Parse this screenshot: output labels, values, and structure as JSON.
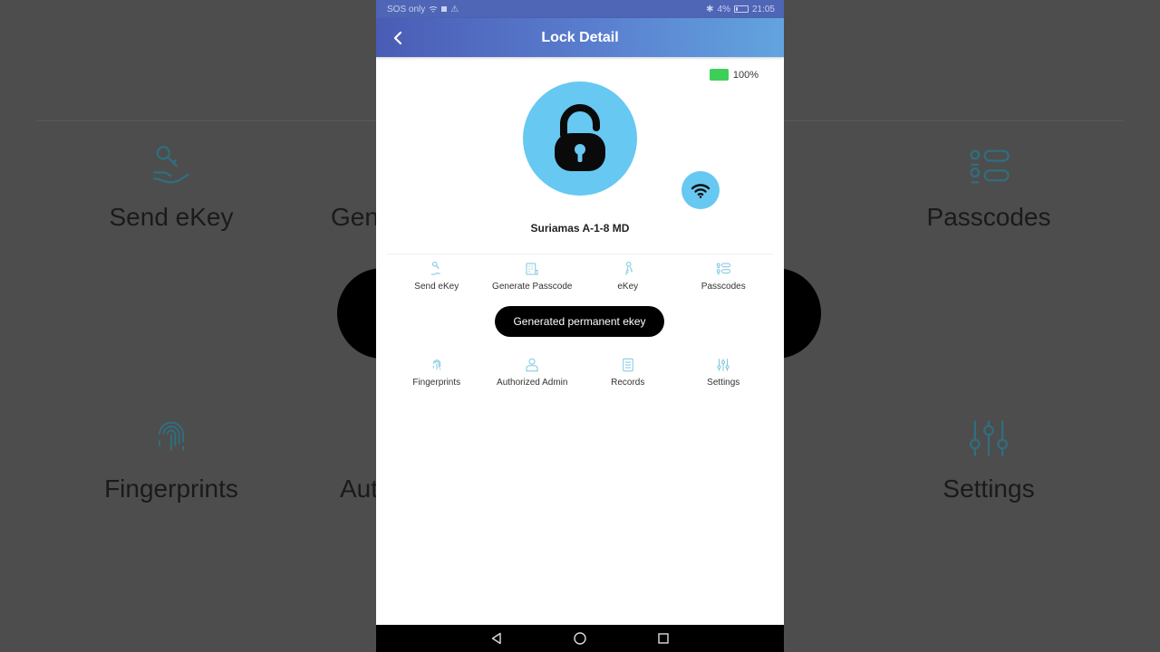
{
  "status_bar": {
    "carrier": "SOS only",
    "battery": "4%",
    "time": "21:05"
  },
  "header": {
    "title": "Lock Detail"
  },
  "lock": {
    "name": "Suriamas A-1-8 MD",
    "battery_level": "100%",
    "accent_color": "#67c8f2",
    "battery_color": "#3ecf5a"
  },
  "menu": {
    "row1": [
      {
        "label": "Send eKey",
        "icon": "send-key-icon"
      },
      {
        "label": "Generate Passcode",
        "icon": "generate-passcode-icon"
      },
      {
        "label": "eKey",
        "icon": "ekey-icon"
      },
      {
        "label": "Passcodes",
        "icon": "passcodes-icon"
      }
    ],
    "row2": [
      {
        "label": "Fingerprints",
        "icon": "fingerprint-icon"
      },
      {
        "label": "Authorized Admin",
        "icon": "authorized-admin-icon"
      },
      {
        "label": "Records",
        "icon": "records-icon"
      },
      {
        "label": "Settings",
        "icon": "settings-icon"
      }
    ]
  },
  "toast": {
    "message": "Generated permanent ekey"
  },
  "backdrop": {
    "send_ekey": "Send eKey",
    "generate_partial": "Gen",
    "passcodes": "Passcodes",
    "fingerprints": "Fingerprints",
    "authorized_partial": "Aut",
    "settings": "Settings"
  }
}
